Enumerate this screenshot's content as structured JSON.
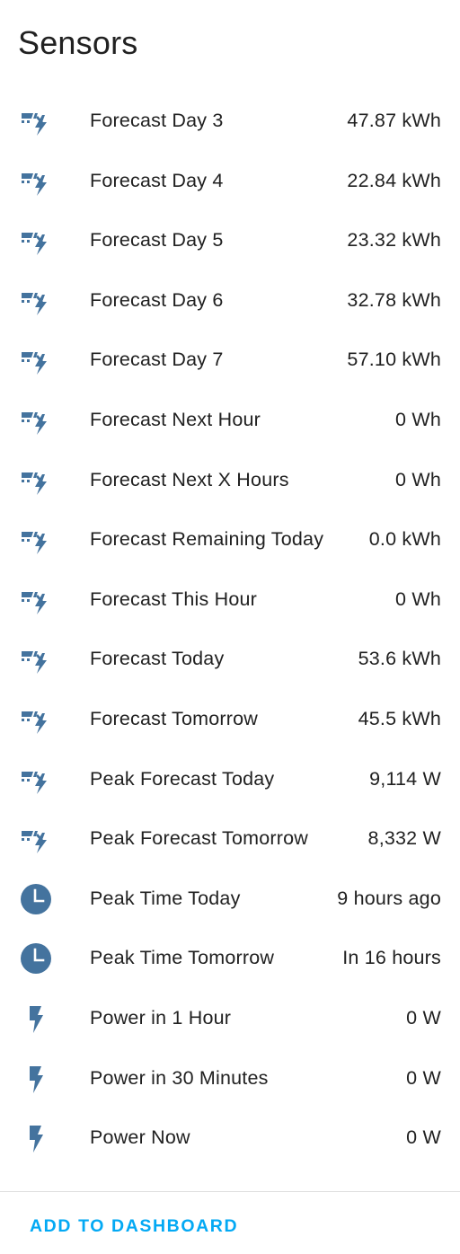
{
  "title": "Sensors",
  "accent_color": "#03a9f4",
  "icon_color": "#44739e",
  "rows": [
    {
      "icon": "solar-power-icon",
      "name": "Forecast Day 3",
      "value": "47.87 kWh"
    },
    {
      "icon": "solar-power-icon",
      "name": "Forecast Day 4",
      "value": "22.84 kWh"
    },
    {
      "icon": "solar-power-icon",
      "name": "Forecast Day 5",
      "value": "23.32 kWh"
    },
    {
      "icon": "solar-power-icon",
      "name": "Forecast Day 6",
      "value": "32.78 kWh"
    },
    {
      "icon": "solar-power-icon",
      "name": "Forecast Day 7",
      "value": "57.10 kWh"
    },
    {
      "icon": "solar-power-icon",
      "name": "Forecast Next Hour",
      "value": "0 Wh"
    },
    {
      "icon": "solar-power-icon",
      "name": "Forecast Next X Hours",
      "value": "0 Wh"
    },
    {
      "icon": "solar-power-icon",
      "name": "Forecast Remaining Today",
      "value": "0.0 kWh"
    },
    {
      "icon": "solar-power-icon",
      "name": "Forecast This Hour",
      "value": "0 Wh"
    },
    {
      "icon": "solar-power-icon",
      "name": "Forecast Today",
      "value": "53.6 kWh"
    },
    {
      "icon": "solar-power-icon",
      "name": "Forecast Tomorrow",
      "value": "45.5 kWh"
    },
    {
      "icon": "solar-power-icon",
      "name": "Peak Forecast Today",
      "value": "9,114 W"
    },
    {
      "icon": "solar-power-icon",
      "name": "Peak Forecast Tomorrow",
      "value": "8,332 W"
    },
    {
      "icon": "clock-icon",
      "name": "Peak Time Today",
      "value": "9 hours ago"
    },
    {
      "icon": "clock-icon",
      "name": "Peak Time Tomorrow",
      "value": "In 16 hours"
    },
    {
      "icon": "lightning-bolt-icon",
      "name": "Power in 1 Hour",
      "value": "0 W"
    },
    {
      "icon": "lightning-bolt-icon",
      "name": "Power in 30 Minutes",
      "value": "0 W"
    },
    {
      "icon": "lightning-bolt-icon",
      "name": "Power Now",
      "value": "0 W"
    }
  ],
  "footer": {
    "add_to_dashboard_label": "ADD TO DASHBOARD"
  }
}
